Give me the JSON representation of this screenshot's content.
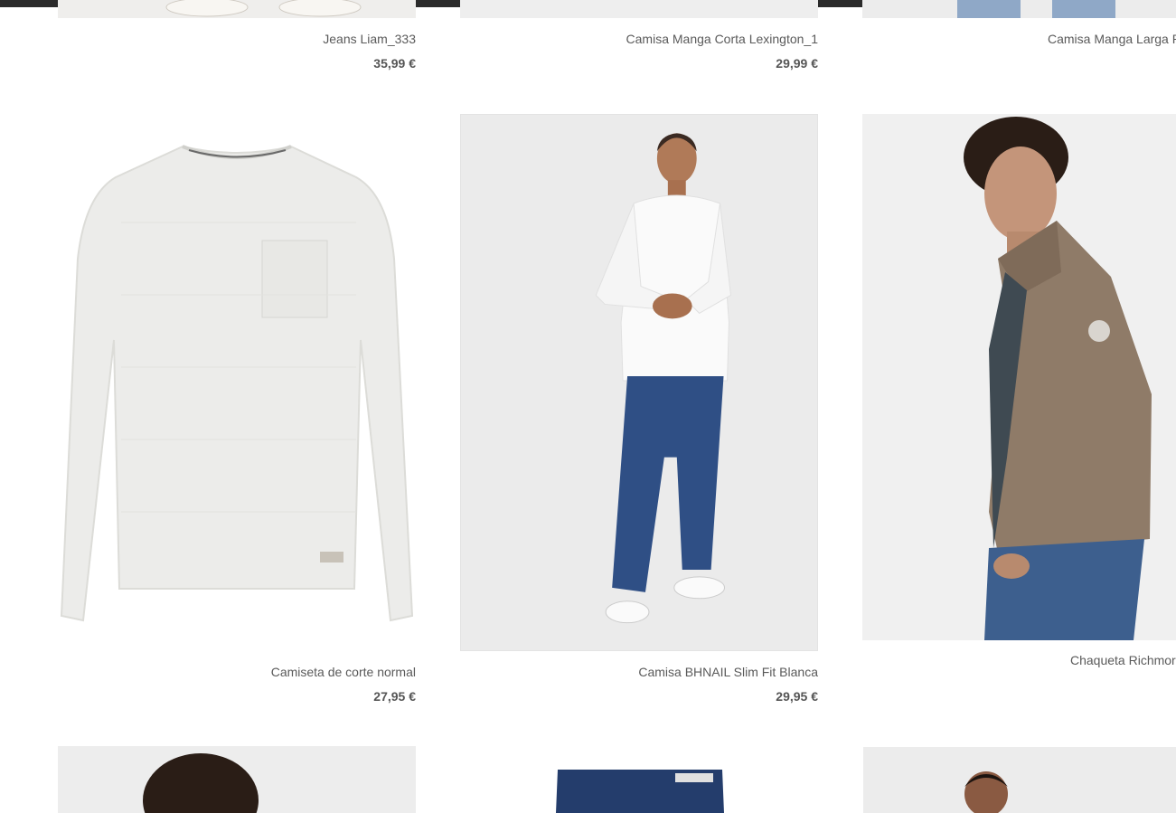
{
  "products": [
    {
      "name": "Jeans Liam_333",
      "price": "35,99 €"
    },
    {
      "name": "Camisa Manga Corta Lexington_1",
      "price": "29,99 €"
    },
    {
      "name": "Camisa Manga Larga P",
      "price": ""
    },
    {
      "name": "Camiseta de corte normal",
      "price": "27,95 €"
    },
    {
      "name": "Camisa BHNAIL Slim Fit Blanca",
      "price": "29,95 €"
    },
    {
      "name": "Chaqueta Richmor",
      "price": ""
    }
  ],
  "colors": {
    "topbar": "#2b2b2b",
    "image_bg": "#eeeeee",
    "text": "#5a5a5a"
  }
}
